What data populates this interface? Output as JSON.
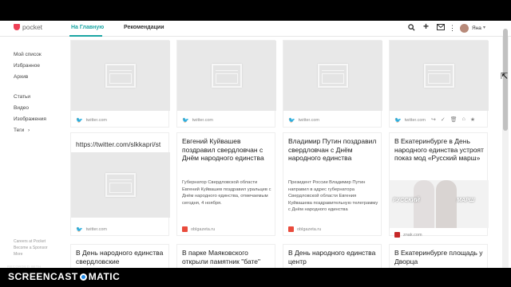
{
  "app": {
    "logo_text": "pocket",
    "tabs": [
      {
        "label": "На Главную",
        "active": true
      },
      {
        "label": "Рекомендации",
        "active": false
      }
    ],
    "user": {
      "name": "Яна"
    },
    "accent_color": "#1aa5a3",
    "brand_color": "#ee4056"
  },
  "sidebar": {
    "items": [
      {
        "label": "Мой список"
      },
      {
        "label": "Избранное"
      },
      {
        "label": "Архив"
      },
      {
        "label": "Статьи"
      },
      {
        "label": "Видео"
      },
      {
        "label": "Изображения"
      },
      {
        "label": "Теги"
      }
    ],
    "footer": [
      "Careers at Pocket",
      "Become a Sponsor",
      "More"
    ]
  },
  "cards": [
    {
      "source": "twitter.com",
      "icon": "twitter-icon"
    },
    {
      "source": "twitter.com",
      "icon": "twitter-icon"
    },
    {
      "source": "twitter.com",
      "icon": "twitter-icon"
    },
    {
      "source": "twitter.com",
      "icon": "twitter-icon"
    },
    {
      "url_title": "https://twitter.com/slkkapri/st",
      "source": "twitter.com",
      "icon": "twitter-icon"
    },
    {
      "title": "Евгений Куйвашев поздравил свердловчан с Днём народного единства",
      "excerpt": "Губернатор Свердловской области Евгений Куйвашев поздравил уральцев с Днём народного единства, отмечаемым сегодня, 4 ноября.",
      "source": "oblgazeta.ru",
      "fav_color": "#e94b3c"
    },
    {
      "title": "Владимир Путин поздравил свердловчан с Днём народного единства",
      "excerpt": "Президент России Владимир Путин направил в адрес губернатора Свердловской области Евгения Куйвашева поздравительную телеграмму с Днём народного единства",
      "source": "oblgazeta.ru",
      "fav_color": "#e94b3c"
    },
    {
      "title": "В Екатеринбурге в День народного единства устроят показ мод «Русский марш»",
      "source": "znak.com",
      "fav_color": "#c62828",
      "poster_text": [
        "РУССКИЙ",
        "МАРШ"
      ]
    },
    {
      "title": "В День народного единства свердловские"
    },
    {
      "title": "В парке Маяковского открыли памятник \"бате\""
    },
    {
      "title": "В День народного единства центр"
    },
    {
      "title": "В Екатеринбурге площадь у Дворца"
    }
  ],
  "watermark": {
    "recorded_with": "RECORDED WITH",
    "brand_left": "SCREENCAST",
    "brand_right": "MATIC"
  }
}
